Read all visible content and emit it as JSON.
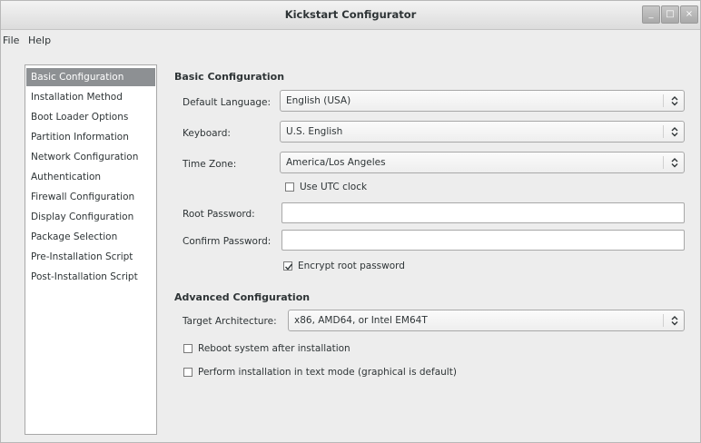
{
  "window": {
    "title": "Kickstart Configurator",
    "buttons": {
      "minimize": "_",
      "maximize": "□",
      "close": "×"
    }
  },
  "menubar": {
    "file": "File",
    "help": "Help"
  },
  "sidebar": {
    "items": [
      {
        "label": "Basic Configuration",
        "selected": true
      },
      {
        "label": "Installation Method",
        "selected": false
      },
      {
        "label": "Boot Loader Options",
        "selected": false
      },
      {
        "label": "Partition Information",
        "selected": false
      },
      {
        "label": "Network Configuration",
        "selected": false
      },
      {
        "label": "Authentication",
        "selected": false
      },
      {
        "label": "Firewall Configuration",
        "selected": false
      },
      {
        "label": "Display Configuration",
        "selected": false
      },
      {
        "label": "Package Selection",
        "selected": false
      },
      {
        "label": "Pre-Installation Script",
        "selected": false
      },
      {
        "label": "Post-Installation Script",
        "selected": false
      }
    ]
  },
  "basic": {
    "section_title": "Basic Configuration",
    "default_language": {
      "label": "Default Language:",
      "value": "English (USA)"
    },
    "keyboard": {
      "label": "Keyboard:",
      "value": "U.S. English"
    },
    "time_zone": {
      "label": "Time Zone:",
      "value": "America/Los Angeles"
    },
    "use_utc": {
      "label": "Use UTC clock",
      "checked": false
    },
    "root_password": {
      "label": "Root Password:",
      "value": ""
    },
    "confirm_password": {
      "label": "Confirm Password:",
      "value": ""
    },
    "encrypt_password": {
      "label": "Encrypt root password",
      "checked": true
    }
  },
  "advanced": {
    "section_title": "Advanced Configuration",
    "target_architecture": {
      "label": "Target Architecture:",
      "value": "x86, AMD64, or Intel EM64T"
    },
    "reboot": {
      "label": "Reboot system after installation",
      "checked": false
    },
    "text_mode": {
      "label": "Perform installation in text mode (graphical is default)",
      "checked": false
    }
  }
}
